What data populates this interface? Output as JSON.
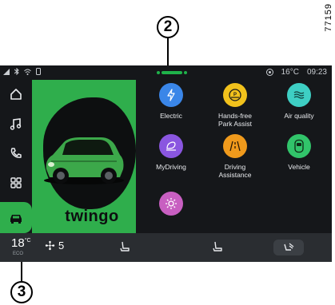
{
  "document": {
    "id": "77159"
  },
  "callouts": [
    {
      "number": "2",
      "target": "Electric"
    },
    {
      "number": "3",
      "target": "vehicle shortcut"
    }
  ],
  "status_bar": {
    "temperature": "16°C",
    "time": "09:23",
    "icons": [
      "signal-icon",
      "bluetooth-icon",
      "wifi-icon",
      "phone-link-icon",
      "notification-icon"
    ]
  },
  "nav_rail": {
    "items": [
      {
        "name": "home",
        "icon": "home-icon"
      },
      {
        "name": "music",
        "icon": "music-icon"
      },
      {
        "name": "phone",
        "icon": "phone-icon"
      },
      {
        "name": "apps",
        "icon": "apps-grid-icon"
      },
      {
        "name": "vehicle",
        "icon": "car-icon",
        "active": true
      }
    ]
  },
  "promo": {
    "brand": "twingo",
    "image": "car-image"
  },
  "apps": [
    {
      "label": "Electric",
      "icon": "lightning-icon",
      "color": "#3a86e8"
    },
    {
      "label": "Hands-free\nPark Assist",
      "icon": "parking-wheel-icon",
      "color": "#f2c21c"
    },
    {
      "label": "Air quality",
      "icon": "air-waves-icon",
      "color": "#3ecfc4"
    },
    {
      "label": "MyDriving",
      "icon": "eco-driving-icon",
      "color": "#8a56e0"
    },
    {
      "label": "Driving\nAssistance",
      "icon": "road-assist-icon",
      "color": "#f09a1c"
    },
    {
      "label": "Vehicle",
      "icon": "vehicle-top-icon",
      "color": "#31c46a"
    },
    {
      "label": "",
      "icon": "settings-icon",
      "color": "#c85fc1"
    }
  ],
  "climate": {
    "temperature": "18",
    "unit": "°C",
    "mode": "ECO",
    "fan_speed": "5",
    "controls": [
      "driver-seat-heat-icon",
      "passenger-seat-heat-icon",
      "airflow-icon"
    ]
  },
  "colors": {
    "brand_green": "#2fae4c",
    "screen_bg": "#15171a",
    "bar_bg": "#2a2d31"
  }
}
